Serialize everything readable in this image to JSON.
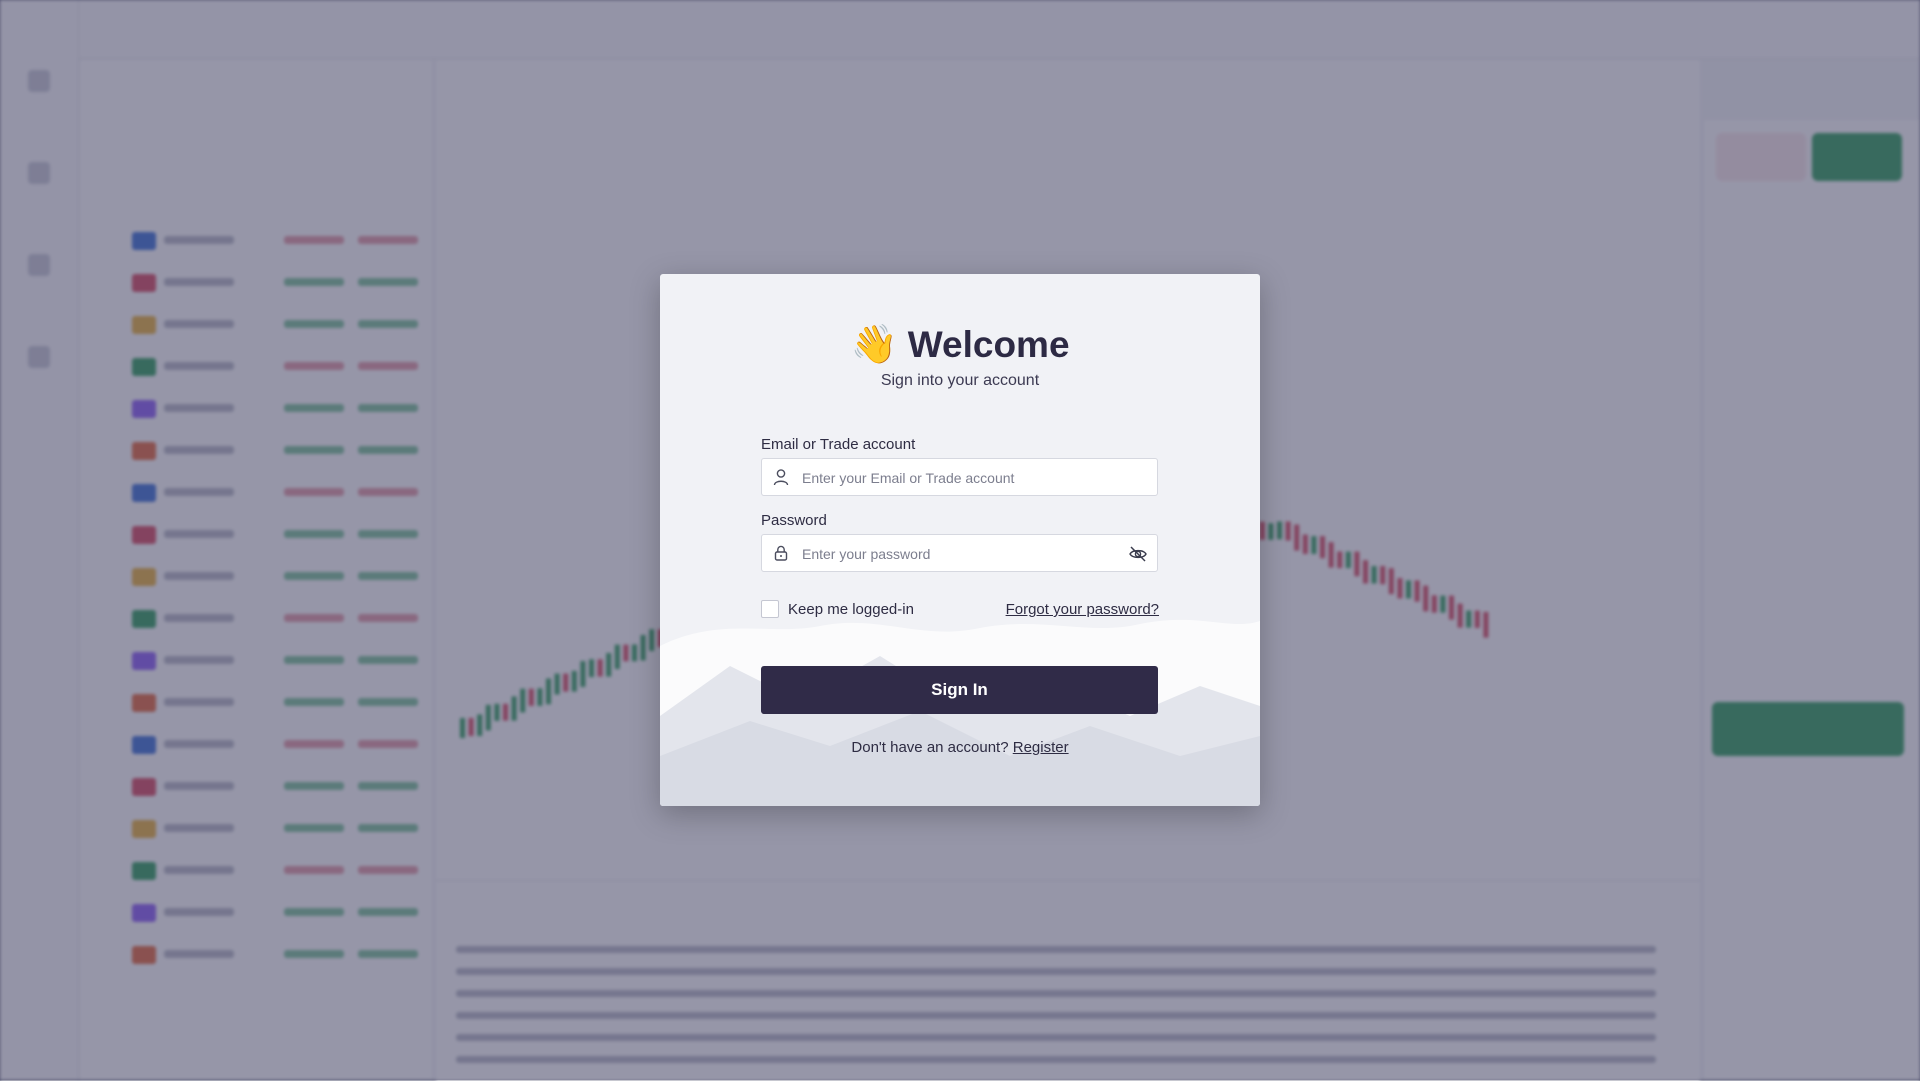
{
  "modal": {
    "wave_emoji": "👋",
    "title": "Welcome",
    "subtitle": "Sign into your account",
    "email": {
      "label": "Email or Trade account",
      "placeholder": "Enter your Email or Trade account",
      "value": "",
      "icon": "user-icon"
    },
    "password": {
      "label": "Password",
      "placeholder": "Enter your password",
      "value": "",
      "icon": "lock-icon",
      "toggle_icon": "eye-off-icon"
    },
    "keep_logged_in": {
      "label": "Keep me logged-in",
      "checked": false
    },
    "forgot_password_label": "Forgot your password?",
    "sign_in_label": "Sign In",
    "no_account_text": "Don't have an account?",
    "register_label": "Register"
  },
  "colors": {
    "button_bg": "#302b48",
    "modal_bg": "#f1f2f6",
    "buy_green": "#2f9e5c",
    "sell_red": "#d8485f"
  }
}
